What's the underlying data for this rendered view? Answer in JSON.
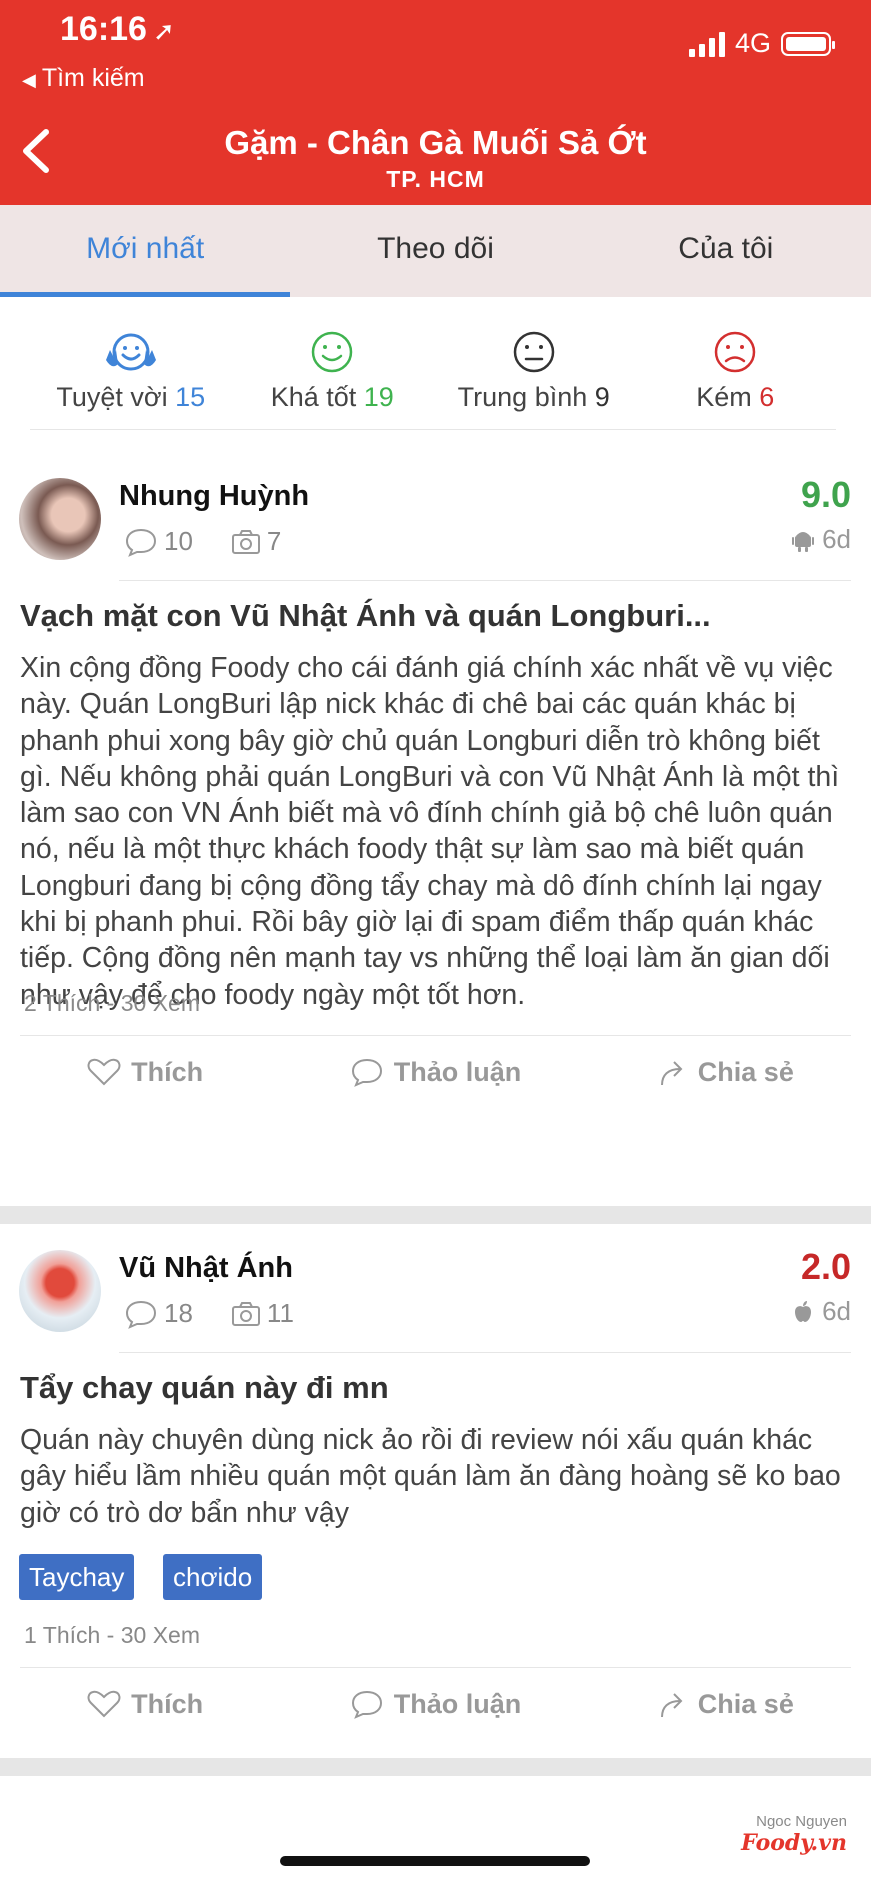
{
  "status_bar": {
    "time": "16:16",
    "network": "4G"
  },
  "back_nav": {
    "label": "Tìm kiếm"
  },
  "header": {
    "title": "Gặm - Chân Gà Muối Sả Ớt",
    "subtitle": "TP. HCM"
  },
  "tabs": [
    {
      "label": "Mới nhất",
      "active": true
    },
    {
      "label": "Theo dõi",
      "active": false
    },
    {
      "label": "Của tôi",
      "active": false
    }
  ],
  "rating_filters": [
    {
      "label": "Tuyệt vời",
      "count": "15",
      "color": "#3f84d8",
      "icon": "very-happy-face-icon"
    },
    {
      "label": "Khá tốt",
      "count": "19",
      "color": "#3fb34f",
      "icon": "smile-face-icon"
    },
    {
      "label": "Trung bình",
      "count": "9",
      "color": "#333333",
      "icon": "neutral-face-icon"
    },
    {
      "label": "Kém",
      "count": "6",
      "color": "#d32f2f",
      "icon": "sad-face-icon"
    }
  ],
  "reviews": [
    {
      "user": "Nhung Huỳnh",
      "comments": "10",
      "photos": "7",
      "score": "9.0",
      "score_color": "#3fa34d",
      "device": "android-icon",
      "time": "6d",
      "title": "Vạch mặt con Vũ Nhật Ánh và quán Longburi...",
      "body": "Xin cộng đồng Foody cho cái đánh giá chính xác nhất về vụ việc này. Quán LongBuri lập nick khác đi chê bai các quán khác bị phanh phui xong bây giờ chủ quán Longburi diễn trò không biết gì. Nếu không phải quán LongBuri và con Vũ Nhật Ánh là một thì làm sao con VN Ánh biết mà vô đính chính giả bộ chê luôn quán nó, nếu là một thực khách foody thật sự làm sao mà biết quán Longburi đang bị cộng đồng tẩy chay mà dô đính chính lại ngay khi bị phanh phui. Rồi bây giờ lại đi spam điểm thấp quán khác tiếp. Cộng đồng nên mạnh tay vs những thể loại làm ăn gian dối như vậy để cho foody ngày một tốt hơn.",
      "stats": "2 Thích - 30 Xem",
      "tags": []
    },
    {
      "user": "Vũ Nhật Ánh",
      "comments": "18",
      "photos": "11",
      "score": "2.0",
      "score_color": "#c62828",
      "device": "apple-icon",
      "time": "6d",
      "title": "Tẩy chay quán này đi mn",
      "body": "Quán này chuyên dùng nick ảo rồi đi review nói xấu quán khác gây hiểu lầm nhiều quán một quán làm ăn đàng hoàng sẽ ko bao giờ có trò dơ bẩn như vậy",
      "stats": "1 Thích - 30 Xem",
      "tags": [
        "Taychay",
        "chơido"
      ]
    }
  ],
  "actions": {
    "like": "Thích",
    "discuss": "Thảo luận",
    "share": "Chia sẻ"
  },
  "watermark": {
    "name": "Ngoc Nguyen",
    "logo": "Foody.vn"
  }
}
